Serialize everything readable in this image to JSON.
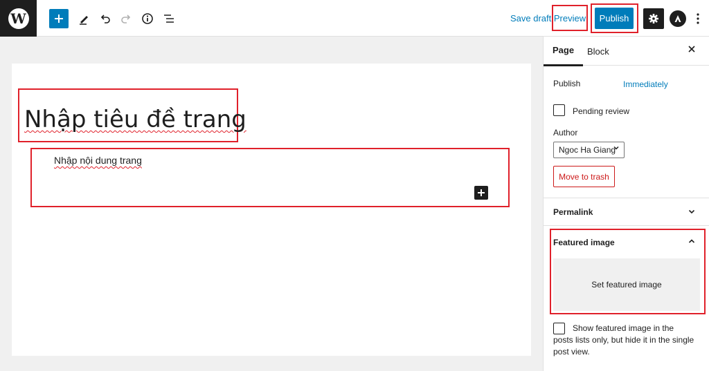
{
  "toolbar": {
    "logo_glyph": "W",
    "save_draft": "Save draft",
    "preview": "Preview",
    "publish": "Publish"
  },
  "editor": {
    "title_placeholder": "Nhập tiêu đề trang",
    "content_placeholder": "Nhập nội dung trang"
  },
  "sidebar": {
    "tabs": {
      "page": "Page",
      "block": "Block"
    },
    "publish_label": "Publish",
    "publish_value": "Immediately",
    "pending_review": "Pending review",
    "author_label": "Author",
    "author_value": "Ngoc Ha Giang",
    "move_to_trash": "Move to trash",
    "permalink": "Permalink",
    "featured_image": "Featured image",
    "set_featured_image": "Set featured image",
    "show_featured_text": "Show featured image in the posts lists only, but hide it in the single post view."
  },
  "colors": {
    "accent": "#007cba",
    "highlight": "#e0202a",
    "trash": "#cc1818",
    "dark": "#1e1e1e"
  }
}
